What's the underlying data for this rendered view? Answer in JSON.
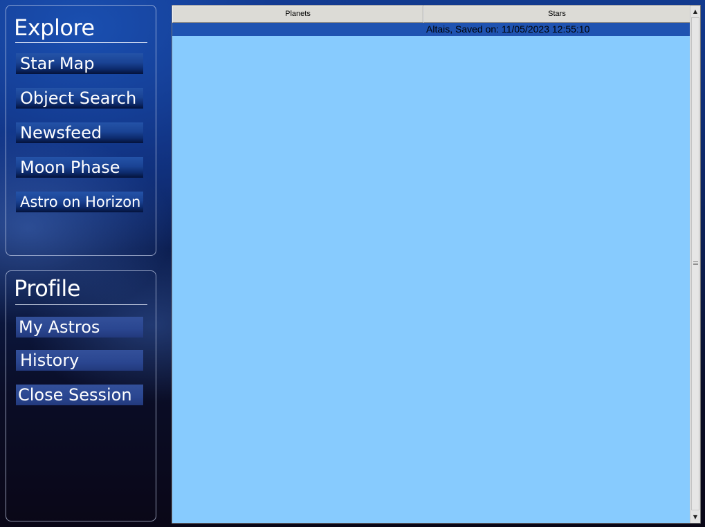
{
  "explore": {
    "title": "Explore",
    "items": [
      {
        "label": "Star Map"
      },
      {
        "label": "Object Search"
      },
      {
        "label": "Newsfeed"
      },
      {
        "label": "Moon Phase"
      },
      {
        "label": "Astro on Horizon"
      }
    ]
  },
  "profile": {
    "title": "Profile",
    "items": [
      {
        "label": "My Astros"
      },
      {
        "label": "History"
      },
      {
        "label": "Close Session"
      }
    ]
  },
  "list": {
    "columns": [
      "Planets",
      "Stars"
    ],
    "rows": [
      {
        "planets": "",
        "stars": "Altais, Saved on: 11/05/2023 12:55:10",
        "selected": true
      }
    ]
  },
  "colors": {
    "list_background": "#87cbfe",
    "selected_row": "#1f53b1"
  },
  "icons": {
    "scroll_up": "scroll-up-arrow-icon",
    "scroll_down": "scroll-down-arrow-icon"
  }
}
